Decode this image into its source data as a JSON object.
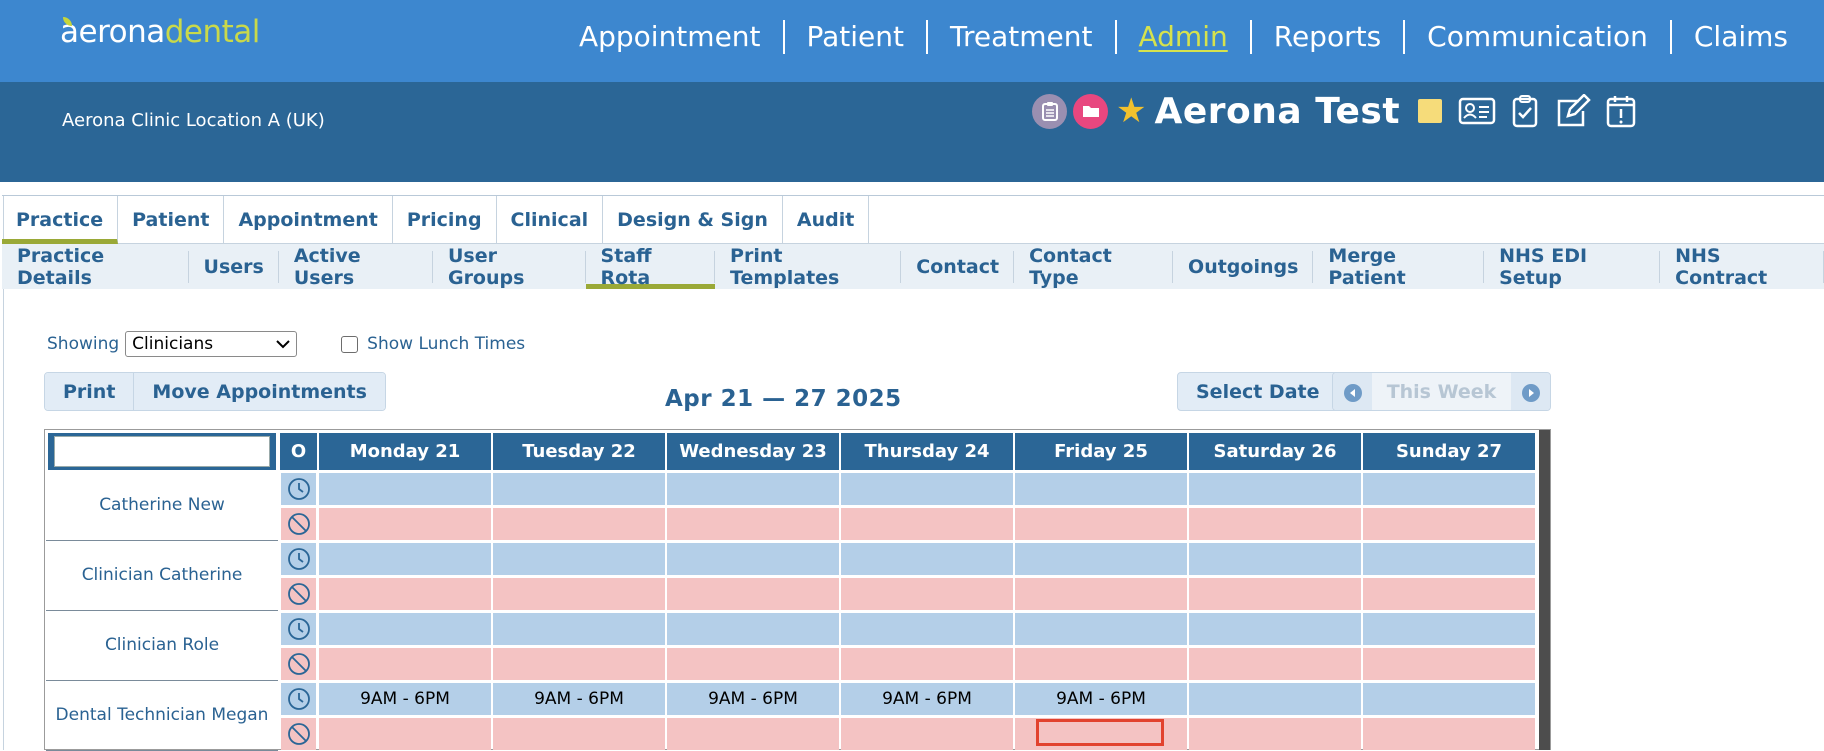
{
  "app": {
    "logo_part1": "aerona",
    "logo_part2": "dental"
  },
  "main_nav": [
    {
      "label": "Appointment",
      "active": false
    },
    {
      "label": "Patient",
      "active": false
    },
    {
      "label": "Treatment",
      "active": false
    },
    {
      "label": "Admin",
      "active": true
    },
    {
      "label": "Reports",
      "active": false
    },
    {
      "label": "Communication",
      "active": false
    },
    {
      "label": "Claims",
      "active": false
    }
  ],
  "location": "Aerona Clinic Location A (UK)",
  "patient": {
    "name": "Aerona Test"
  },
  "tabs": [
    {
      "label": "Practice",
      "active": true
    },
    {
      "label": "Patient",
      "active": false
    },
    {
      "label": "Appointment",
      "active": false
    },
    {
      "label": "Pricing",
      "active": false
    },
    {
      "label": "Clinical",
      "active": false
    },
    {
      "label": "Design & Sign",
      "active": false
    },
    {
      "label": "Audit",
      "active": false
    }
  ],
  "subtabs": [
    {
      "label": "Practice Details",
      "active": false
    },
    {
      "label": "Users",
      "active": false
    },
    {
      "label": "Active Users",
      "active": false
    },
    {
      "label": "User Groups",
      "active": false
    },
    {
      "label": "Staff Rota",
      "active": true
    },
    {
      "label": "Print Templates",
      "active": false
    },
    {
      "label": "Contact",
      "active": false
    },
    {
      "label": "Contact Type",
      "active": false
    },
    {
      "label": "Outgoings",
      "active": false
    },
    {
      "label": "Merge Patient",
      "active": false
    },
    {
      "label": "NHS EDI Setup",
      "active": false
    },
    {
      "label": "NHS Contract",
      "active": false
    }
  ],
  "controls": {
    "showing_label": "Showing",
    "showing_value": "Clinicians",
    "lunch_label": "Show Lunch Times",
    "print_label": "Print",
    "move_label": "Move Appointments",
    "date_range": "Apr 21 — 27 2025",
    "select_date_label": "Select Date",
    "this_week_label": "This Week"
  },
  "grid": {
    "o_header": "O",
    "days": [
      "Monday 21",
      "Tuesday 22",
      "Wednesday 23",
      "Thursday 24",
      "Friday 25",
      "Saturday 26",
      "Sunday 27"
    ],
    "staff": [
      {
        "name": "Catherine New",
        "hours": [
          "",
          "",
          "",
          "",
          "",
          "",
          ""
        ]
      },
      {
        "name": "Clinician Catherine",
        "hours": [
          "",
          "",
          "",
          "",
          "",
          "",
          ""
        ]
      },
      {
        "name": "Clinician Role",
        "hours": [
          "",
          "",
          "",
          "",
          "",
          "",
          ""
        ]
      },
      {
        "name": "Dental Technician Megan",
        "hours": [
          "9AM - 6PM",
          "9AM - 6PM",
          "9AM - 6PM",
          "9AM - 6PM",
          "9AM - 6PM",
          "",
          ""
        ]
      }
    ]
  },
  "colors": {
    "topbar": "#3d87cf",
    "band": "#2b6696",
    "accent": "#9aa937",
    "working_row": "#b4cfe8",
    "absence_row": "#f4c3c3",
    "selection": "#e2422e"
  }
}
